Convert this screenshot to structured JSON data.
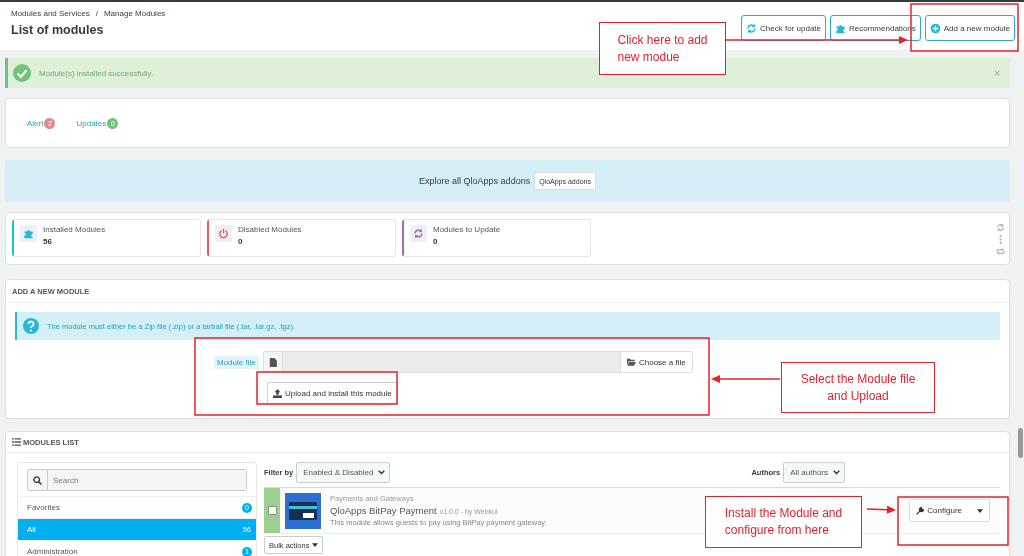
{
  "breadcrumb": {
    "items": [
      "Modules and Services",
      "Manage Modules"
    ],
    "separator": "/"
  },
  "page_title": "List of modules",
  "toolbar_buttons": [
    {
      "label": "Check for update",
      "kind": "refresh"
    },
    {
      "label": "Recommendations",
      "kind": "puzzle"
    },
    {
      "label": "Add a new module",
      "kind": "add"
    }
  ],
  "success_alert": {
    "message": "Module(s) installed successfully.",
    "close": "×"
  },
  "notices": [
    {
      "label": "Alert",
      "count": "2",
      "color": "#e08a8a"
    },
    {
      "label": "Updates",
      "count": "0",
      "color": "#72c279"
    }
  ],
  "addons_banner": {
    "text": "Explore all QloApps addons",
    "button": "QloApps addons"
  },
  "kpis": [
    {
      "label": "Installed Modules",
      "value": "56",
      "kind": "installed",
      "color": "#25b9d7"
    },
    {
      "label": "Disabled Modules",
      "value": "0",
      "kind": "disabled",
      "color": "#e6595f"
    },
    {
      "label": "Modules to Update",
      "value": "0",
      "kind": "update",
      "color": "#a868b3"
    }
  ],
  "add_module": {
    "heading": "ADD A NEW MODULE",
    "info": "The module must either be a Zip file (.zip) or a tarball file (.tar, .tar.gz, .tgz).",
    "field_label": "Module file",
    "choose_button": "Choose a file",
    "upload_button": "Upload and install this module"
  },
  "modules_list": {
    "heading": "MODULES LIST",
    "search_placeholder": "Search",
    "categories": [
      {
        "name": "Favorites",
        "count": "0",
        "selected": false
      },
      {
        "name": "All",
        "count": "56",
        "selected": true
      },
      {
        "name": "Administration",
        "count": "1",
        "selected": false
      }
    ],
    "filter_label": "Filter by",
    "filter_value": "Enabled & Disabled",
    "authors_label": "Authors",
    "authors_value": "All authors",
    "modules": [
      {
        "category": "Payments and Gateways",
        "name": "QloApps BitPay Payment",
        "meta": "v1.0.0 - by Webkul",
        "description": "This module allows guests to pay using BitPay payment gateway.",
        "checked": false,
        "action": "Configure"
      }
    ],
    "bulk_actions": "Bulk actions"
  },
  "annotations": [
    {
      "kind": "add",
      "lines": [
        "Click here to add",
        "new modue"
      ]
    },
    {
      "kind": "upload",
      "lines": [
        "Select the Module file",
        "and Upload"
      ]
    },
    {
      "kind": "configure",
      "lines": [
        "Install the Module and",
        "configure from here"
      ]
    }
  ]
}
